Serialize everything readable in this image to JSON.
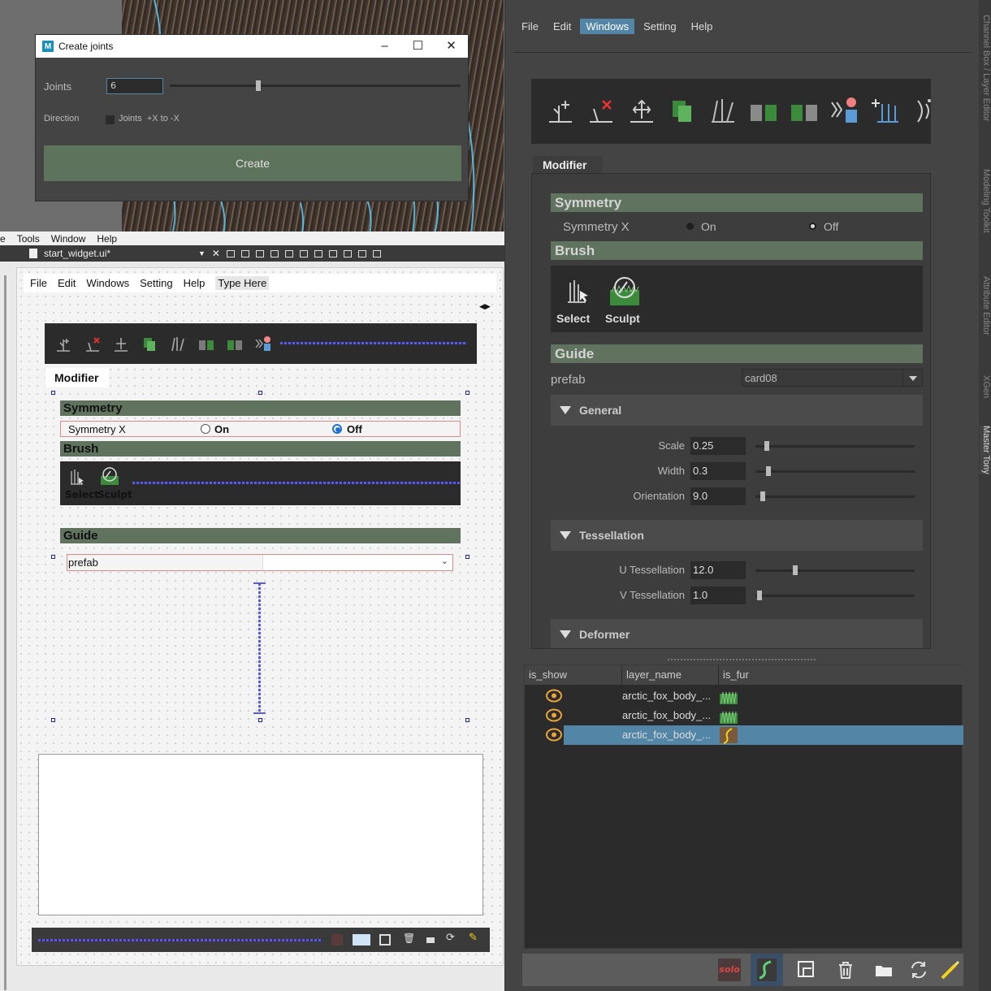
{
  "dialog": {
    "title": "Create joints",
    "joints_label": "Joints",
    "joints_value": "6",
    "joints_slider_fraction": 0.3,
    "direction_label": "Direction",
    "direction_checkbox_label": "Joints  +X to -X",
    "create_label": "Create"
  },
  "designer": {
    "menubar": [
      "e",
      "Tools",
      "Window",
      "Help"
    ],
    "file_tab": "start_widget.ui*",
    "form": {
      "menubar": [
        "File",
        "Edit",
        "Windows",
        "Setting",
        "Help",
        "Type Here"
      ],
      "modifier_tab": "Modifier",
      "symmetry_header": "Symmetry",
      "symmetry_label": "Symmetry X",
      "on_label": "On",
      "off_label": "Off",
      "off_selected": true,
      "brush_header": "Brush",
      "select_label": "Select",
      "sculpt_label": "Sculpt",
      "guide_header": "Guide",
      "prefab_label": "prefab"
    }
  },
  "panel": {
    "menubar": [
      "File",
      "Edit",
      "Windows",
      "Setting",
      "Help"
    ],
    "active_menu": "Windows",
    "modifier_tab": "Modifier",
    "symmetry_header": "Symmetry",
    "symmetry_label": "Symmetry X",
    "on_label": "On",
    "off_label": "Off",
    "off_selected": true,
    "brush_header": "Brush",
    "select_label": "Select",
    "sculpt_label": "Sculpt",
    "guide_header": "Guide",
    "prefab_label": "prefab",
    "prefab_value": "card08",
    "general": {
      "title": "General",
      "fields": [
        {
          "label": "Scale",
          "value": "0.25",
          "slider": 0.06
        },
        {
          "label": "Width",
          "value": "0.3",
          "slider": 0.07
        },
        {
          "label": "Orientation",
          "value": "9.0",
          "slider": 0.03
        }
      ]
    },
    "tessellation": {
      "title": "Tessellation",
      "fields": [
        {
          "label": "U Tessellation",
          "value": "12.0",
          "slider": 0.24
        },
        {
          "label": "V Tessellation",
          "value": "1.0",
          "slider": 0.01
        }
      ]
    },
    "deformer_title": "Deformer",
    "table": {
      "columns": [
        "is_show",
        "layer_name",
        "is_fur"
      ],
      "rows": [
        {
          "name": "arctic_fox_body_...",
          "selected": false
        },
        {
          "name": "arctic_fox_body_...",
          "selected": false
        },
        {
          "name": "arctic_fox_body_...",
          "selected": true
        }
      ]
    },
    "bottom_solo_label": "solo",
    "side_tabs": [
      "Channel Box / Layer Editor",
      "Modeling Toolkit",
      "Attribute Editor",
      "XGen",
      "Master Tony"
    ],
    "active_side_tab": "Master Tony"
  },
  "colors": {
    "section_green": "#5f735e",
    "accent_blue": "#5285a6",
    "eye_orange": "#e8a33a"
  }
}
